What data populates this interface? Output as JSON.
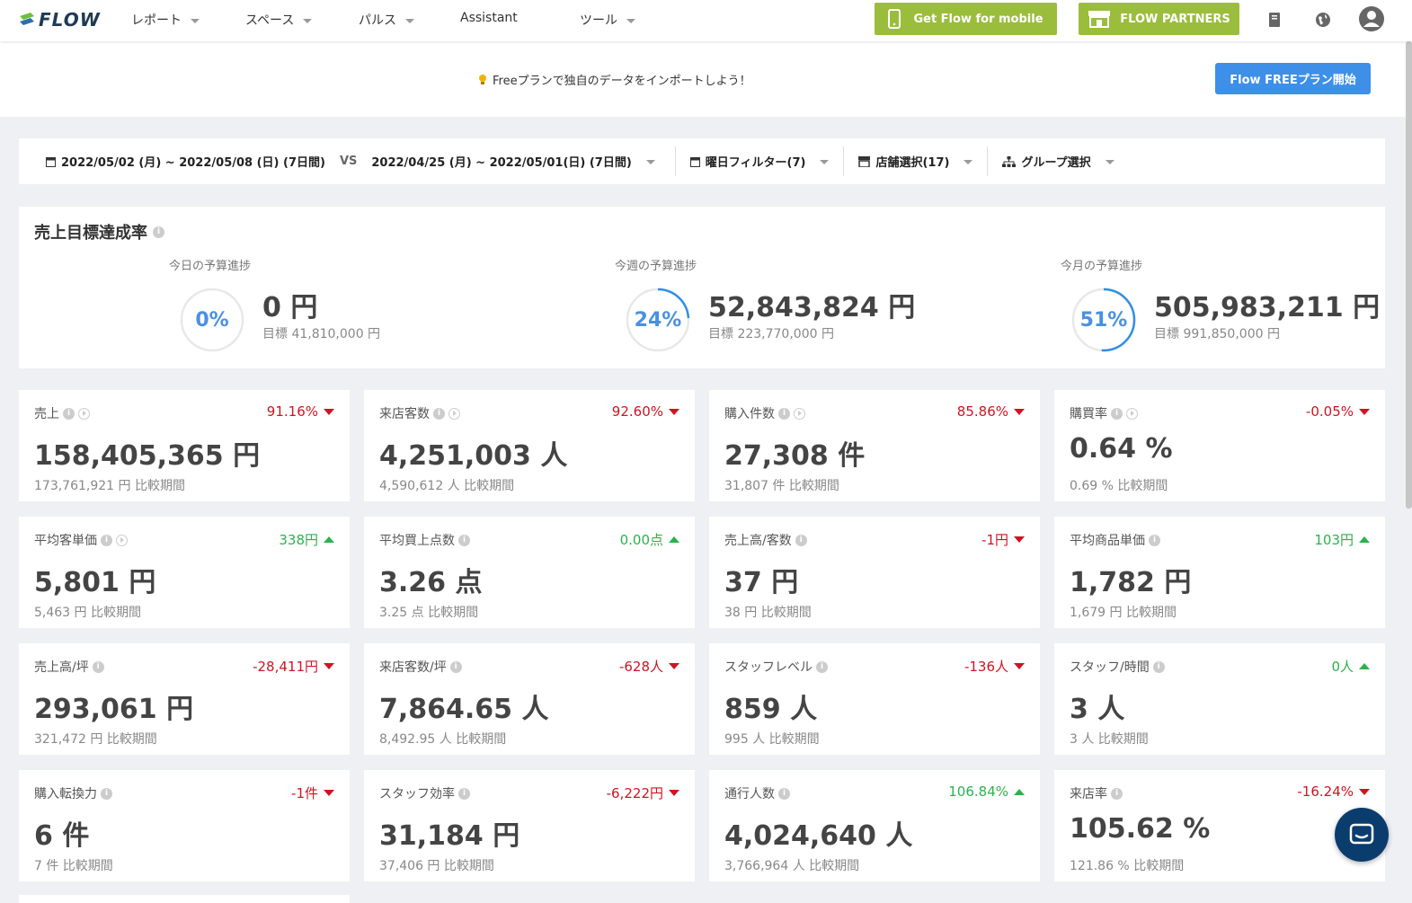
{
  "nav": {
    "logo": "FLOW",
    "items": [
      "レポート",
      "スペース",
      "パルス",
      "Assistant",
      "ツール"
    ],
    "mobile_btn": "Get Flow for mobile",
    "partners_btn": "FLOW PARTNERS"
  },
  "banner": {
    "message": "Freeプランで独自のデータをインポートしよう！",
    "cta": "Flow FREEプラン開始"
  },
  "filters": {
    "period": "2022/05/02 (月) ~ 2022/05/08 (日) (7日間)",
    "vs": "VS",
    "compare_period": "2022/04/25 (月) ~ 2022/05/01(日) (7日間)",
    "weekday": "曜日フィルター(7)",
    "store": "店舗選択(17)",
    "group": "グループ選択"
  },
  "goals": {
    "title": "売上目標達成率",
    "items": [
      {
        "label": "今日の予算進捗",
        "percent": 0,
        "percent_text": "0%",
        "amount": "0 円",
        "target": "目標 41,810,000 円"
      },
      {
        "label": "今週の予算進捗",
        "percent": 24,
        "percent_text": "24%",
        "amount": "52,843,824 円",
        "target": "目標 223,770,000 円"
      },
      {
        "label": "今月の予算進捗",
        "percent": 51,
        "percent_text": "51%",
        "amount": "505,983,211 円",
        "target": "目標 991,850,000 円"
      }
    ]
  },
  "metrics": [
    {
      "label": "売上",
      "play": true,
      "change": "91.16%",
      "dir": "down",
      "value": "158,405,365 円",
      "compare": "173,761,921 円 比較期間"
    },
    {
      "label": "来店客数",
      "play": true,
      "change": "92.60%",
      "dir": "down",
      "value": "4,251,003 人",
      "compare": "4,590,612 人 比較期間"
    },
    {
      "label": "購入件数",
      "play": true,
      "change": "85.86%",
      "dir": "down",
      "value": "27,308 件",
      "compare": "31,807 件 比較期間"
    },
    {
      "label": "購買率",
      "play": true,
      "change": "-0.05%",
      "dir": "down",
      "value": "0.64 %",
      "compare": "0.69 % 比較期間"
    },
    {
      "label": "平均客単価",
      "play": true,
      "change": "338円",
      "dir": "up",
      "value": "5,801 円",
      "compare": "5,463 円 比較期間"
    },
    {
      "label": "平均買上点数",
      "play": false,
      "change": "0.00点",
      "dir": "up",
      "value": "3.26 点",
      "compare": "3.25 点 比較期間"
    },
    {
      "label": "売上高/客数",
      "play": false,
      "change": "-1円",
      "dir": "down",
      "value": "37 円",
      "compare": "38 円 比較期間"
    },
    {
      "label": "平均商品単価",
      "play": false,
      "change": "103円",
      "dir": "up",
      "value": "1,782 円",
      "compare": "1,679 円 比較期間"
    },
    {
      "label": "売上高/坪",
      "play": false,
      "change": "-28,411円",
      "dir": "down",
      "value": "293,061 円",
      "compare": "321,472 円 比較期間"
    },
    {
      "label": "来店客数/坪",
      "play": false,
      "change": "-628人",
      "dir": "down",
      "value": "7,864.65 人",
      "compare": "8,492.95 人 比較期間"
    },
    {
      "label": "スタッフレベル",
      "play": false,
      "change": "-136人",
      "dir": "down",
      "value": "859 人",
      "compare": "995 人 比較期間"
    },
    {
      "label": "スタッフ/時間",
      "play": false,
      "change": "0人",
      "dir": "up",
      "value": "3 人",
      "compare": "3 人 比較期間"
    },
    {
      "label": "購入転換力",
      "play": false,
      "change": "-1件",
      "dir": "down",
      "value": "6 件",
      "compare": "7 件 比較期間"
    },
    {
      "label": "スタッフ効率",
      "play": false,
      "change": "-6,222円",
      "dir": "down",
      "value": "31,184 円",
      "compare": "37,406 円 比較期間"
    },
    {
      "label": "通行人数",
      "play": false,
      "change": "106.84%",
      "dir": "up",
      "value": "4,024,640 人",
      "compare": "3,766,964 人 比較期間"
    },
    {
      "label": "来店率",
      "play": false,
      "change": "-16.24%",
      "dir": "down",
      "value": "105.62 %",
      "compare": "121.86 % 比較期間"
    }
  ]
}
